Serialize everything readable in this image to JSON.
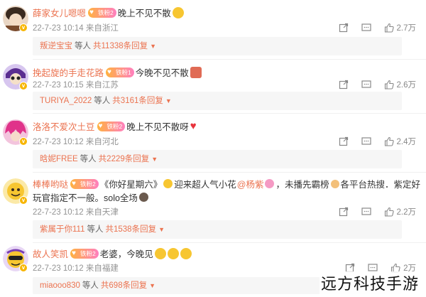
{
  "comments": [
    {
      "user": "薛家女儿嗯嗯",
      "fan_badge": "铁粉2",
      "text": "晚上不见不散",
      "emojis": [
        "#f7c631"
      ],
      "date": "22-7-23",
      "time": "10:14",
      "location": "来自浙江",
      "likes": "2.7万",
      "reply_user": "叛逆宝宝",
      "reply_mid": "等人",
      "reply_total": "共11338条回复"
    },
    {
      "user": "挽起旋的手走花路",
      "fan_badge": "铁粉1",
      "text": "今晚不见不散",
      "emojis": [
        "#e06b55"
      ],
      "date": "22-7-23",
      "time": "10:15",
      "location": "来自江苏",
      "likes": "2.6万",
      "reply_user": "TURIYA_2022",
      "reply_mid": "等人",
      "reply_total": "共3161条回复"
    },
    {
      "user": "洛洛不爱次土豆",
      "fan_badge": "铁粉2",
      "text": "晚上不见不散呀",
      "emojis": [
        "#e8333c"
      ],
      "date": "22-7-23",
      "time": "10:12",
      "location": "来自河北",
      "likes": "2.4万",
      "reply_user": "晗妮FREE",
      "reply_mid": "等人",
      "reply_total": "共2229条回复"
    },
    {
      "user": "棒棒哟哒",
      "fan_badge": "铁粉2",
      "text": "《你好星期六》",
      "text2": "迎来超人气小花",
      "mention": "@杨紫",
      "text3": "，未播先霸榜",
      "text4": "各平台热搜．紫定好",
      "text_line2": "玩官指定不一般。solo全场",
      "emojis": [
        "#f7c631"
      ],
      "date": "22-7-23",
      "time": "10:12",
      "location": "来自天津",
      "likes": "2.2万",
      "reply_user": "紫属于你111",
      "reply_mid": "等人",
      "reply_total": "共1538条回复"
    },
    {
      "user": "故人笑凯",
      "fan_badge": "铁粉2",
      "text": "老婆，今晚见",
      "emojis": [
        "#f7c631",
        "#f7c631",
        "#f7c631"
      ],
      "date": "22-7-23",
      "time": "10:12",
      "location": "来自福建",
      "likes": "2万",
      "reply_user": "miaooo830",
      "reply_mid": "等人",
      "reply_total": "共698条回复"
    }
  ],
  "icons": {
    "share": "share-icon",
    "comment": "comment-icon",
    "like": "like-icon",
    "verified": "verified-badge-icon"
  },
  "colors": {
    "username": "#eb7350",
    "meta": "#939393",
    "reply_bg": "#f6f6f6"
  },
  "watermark": "远方科技手游"
}
